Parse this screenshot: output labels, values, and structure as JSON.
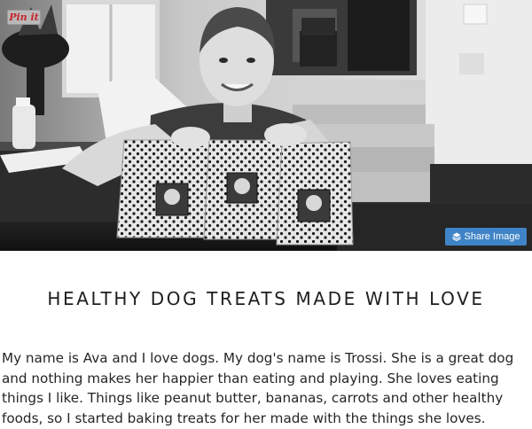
{
  "hero": {
    "pin_label": "Pin it",
    "share_label": "Share Image"
  },
  "article": {
    "heading": "HEALTHY DOG TREATS MADE WITH LOVE",
    "body": "My name is Ava and I love dogs. My dog's name is Trossi. She is a great dog and nothing makes her happier than eating and playing. She loves eating things I like. Things like peanut butter, bananas, carrots and other healthy foods, so I started baking treats for her made with the things she loves."
  },
  "colors": {
    "share_button": "#3f84c6",
    "pin_text": "#c6262a",
    "heading_text": "#1e1e1e",
    "body_text": "#262626"
  },
  "icons": {
    "share": "layers-icon"
  }
}
